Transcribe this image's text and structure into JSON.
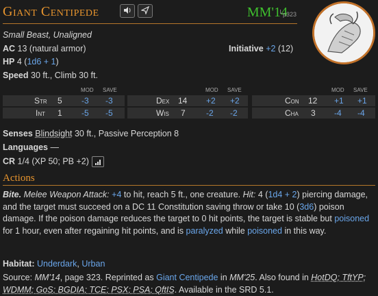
{
  "header": {
    "name": "Giant Centipede",
    "source_abbr": "MM'14",
    "source_l": "L",
    "source_page": "p323"
  },
  "meta": {
    "size_type": "Small Beast, Unaligned",
    "ac_label": "AC",
    "ac_value": "13 (natural armor)",
    "init_label": "Initiative",
    "init_mod": "+2",
    "init_score": "(12)",
    "hp_label": "HP",
    "hp_value": "4",
    "hp_formula": "1d6 + 1",
    "speed_label": "Speed",
    "speed_value": "30 ft., Climb 30 ft."
  },
  "stat_headers": {
    "mod": "MOD",
    "save": "SAVE"
  },
  "abilities": [
    {
      "name": "Str",
      "score": "5",
      "mod": "-3",
      "save": "-3"
    },
    {
      "name": "Int",
      "score": "1",
      "mod": "-5",
      "save": "-5"
    },
    {
      "name": "Dex",
      "score": "14",
      "mod": "+2",
      "save": "+2"
    },
    {
      "name": "Wis",
      "score": "7",
      "mod": "-2",
      "save": "-2"
    },
    {
      "name": "Con",
      "score": "12",
      "mod": "+1",
      "save": "+1"
    },
    {
      "name": "Cha",
      "score": "3",
      "mod": "-4",
      "save": "-4"
    }
  ],
  "senses": {
    "label": "Senses",
    "blindsight": "Blindsight",
    "rest": "30 ft., Passive Perception 8"
  },
  "languages": {
    "label": "Languages",
    "value": "—"
  },
  "cr": {
    "label": "CR",
    "value": "1/4 (XP 50; PB +2)"
  },
  "actions": {
    "title": "Actions",
    "bite": {
      "name": "Bite.",
      "attack_type": "Melee Weapon Attack:",
      "to_hit": "+4",
      "t1": "to hit, reach 5 ft., one creature.",
      "hit_label": "Hit:",
      "t2": "4 (",
      "dmg1": "1d4 + 2",
      "t3": ") piercing damage, and the target must succeed on a DC 11 Constitution saving throw or take 10 (",
      "dmg2": "3d6",
      "t4": ") poison damage. If the poison damage reduces the target to 0 hit points, the target is stable but",
      "poisoned": "poisoned",
      "t5": "for 1 hour, even after regaining hit points, and is",
      "paralyzed": "paralyzed",
      "t6": "while",
      "poisoned2": "poisoned",
      "t7": "in this way."
    }
  },
  "habitat": {
    "label": "Habitat:",
    "v1": "Underdark",
    "sep": ",",
    "v2": "Urban"
  },
  "source": {
    "label": "Source:",
    "book": "MM'14",
    "t1": ", page 323. Reprinted as",
    "link": "Giant Centipede",
    "t2": "in",
    "book2": "MM'25",
    "t3": ". Also found in",
    "books": "HotDQ; TftYP; WDMM; GoS; BGDIA; TCE; PSX; PSA; QftIS",
    "t4": ". Available in the SRD 5.1."
  }
}
